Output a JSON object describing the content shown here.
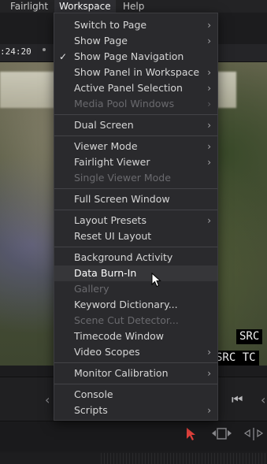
{
  "menubar": {
    "items": [
      "Fairlight",
      "Workspace",
      "Help"
    ]
  },
  "viewer": {
    "timecode": ":24:20",
    "burnin_line1": "SRC",
    "burnin_line2": "SRC TC"
  },
  "workspace_menu": {
    "items": [
      {
        "label": "Switch to Page",
        "submenu": true,
        "enabled": true
      },
      {
        "label": "Show Page",
        "submenu": true,
        "enabled": true
      },
      {
        "label": "Show Page Navigation",
        "checked": true,
        "enabled": true
      },
      {
        "label": "Show Panel in Workspace",
        "submenu": true,
        "enabled": true
      },
      {
        "label": "Active Panel Selection",
        "submenu": true,
        "enabled": true
      },
      {
        "label": "Media Pool Windows",
        "submenu": true,
        "enabled": false
      },
      {
        "label": "Dual Screen",
        "submenu": true,
        "enabled": true
      },
      {
        "label": "Viewer Mode",
        "submenu": true,
        "enabled": true
      },
      {
        "label": "Fairlight Viewer",
        "submenu": true,
        "enabled": true
      },
      {
        "label": "Single Viewer Mode",
        "enabled": false
      },
      {
        "label": "Full Screen Window",
        "enabled": true
      },
      {
        "label": "Layout Presets",
        "submenu": true,
        "enabled": true
      },
      {
        "label": "Reset UI Layout",
        "enabled": true
      },
      {
        "label": "Background Activity",
        "enabled": true
      },
      {
        "label": "Data Burn-In",
        "enabled": true,
        "hovered": true
      },
      {
        "label": "Gallery",
        "enabled": false
      },
      {
        "label": "Keyword Dictionary...",
        "enabled": true
      },
      {
        "label": "Scene Cut Detector...",
        "enabled": false
      },
      {
        "label": "Timecode Window",
        "enabled": true
      },
      {
        "label": "Video Scopes",
        "submenu": true,
        "enabled": true
      },
      {
        "label": "Monitor Calibration",
        "submenu": true,
        "enabled": true
      },
      {
        "label": "Console",
        "enabled": true
      },
      {
        "label": "Scripts",
        "submenu": true,
        "enabled": true
      }
    ]
  },
  "icons": {
    "check": "✓",
    "submenu_arrow": "›",
    "transport_prev": "⏮",
    "transport_left": "‹",
    "select_tool": "arrow-pointer-icon",
    "trim_tool": "trim-icon",
    "blade_tool": "blade-icon"
  },
  "colors": {
    "menu_bg": "#2a2a2d",
    "menu_hover": "#363639",
    "selection_tool": "#e0413c"
  }
}
